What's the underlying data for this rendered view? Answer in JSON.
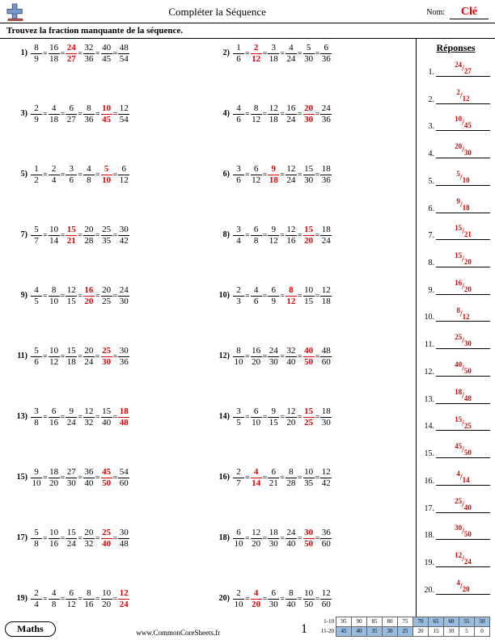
{
  "header": {
    "title": "Compléter la Séquence",
    "nom_label": "Nom:",
    "nom_value": "Clé"
  },
  "instruction": "Trouvez la fraction manquante de la séquence.",
  "answers_title": "Réponses",
  "footer": {
    "maths": "Maths",
    "site": "www.CommonCoreSheets.fr",
    "page": "1",
    "score_labels": [
      "1-10",
      "11-20"
    ],
    "score_rows": [
      [
        "95",
        "90",
        "85",
        "80",
        "75",
        "70",
        "65",
        "60",
        "55",
        "50"
      ],
      [
        "45",
        "40",
        "35",
        "30",
        "25",
        "20",
        "15",
        "10",
        "5",
        "0"
      ]
    ],
    "highlight_row2_count": 5
  },
  "problems": [
    {
      "n": 1,
      "fr": [
        [
          8,
          9
        ],
        [
          16,
          18
        ],
        [
          24,
          27
        ],
        [
          32,
          36
        ],
        [
          40,
          45
        ],
        [
          48,
          54
        ]
      ],
      "miss": 2
    },
    {
      "n": 2,
      "fr": [
        [
          1,
          6
        ],
        [
          2,
          12
        ],
        [
          3,
          18
        ],
        [
          4,
          24
        ],
        [
          5,
          30
        ],
        [
          6,
          36
        ]
      ],
      "miss": 1
    },
    {
      "n": 3,
      "fr": [
        [
          2,
          9
        ],
        [
          4,
          18
        ],
        [
          6,
          27
        ],
        [
          8,
          36
        ],
        [
          10,
          45
        ],
        [
          12,
          54
        ]
      ],
      "miss": 4
    },
    {
      "n": 4,
      "fr": [
        [
          4,
          6
        ],
        [
          8,
          12
        ],
        [
          12,
          18
        ],
        [
          16,
          24
        ],
        [
          20,
          30
        ],
        [
          24,
          36
        ]
      ],
      "miss": 4
    },
    {
      "n": 5,
      "fr": [
        [
          1,
          2
        ],
        [
          2,
          4
        ],
        [
          3,
          6
        ],
        [
          4,
          8
        ],
        [
          5,
          10
        ],
        [
          6,
          12
        ]
      ],
      "miss": 4
    },
    {
      "n": 6,
      "fr": [
        [
          3,
          6
        ],
        [
          6,
          12
        ],
        [
          9,
          18
        ],
        [
          12,
          24
        ],
        [
          15,
          30
        ],
        [
          18,
          36
        ]
      ],
      "miss": 2
    },
    {
      "n": 7,
      "fr": [
        [
          5,
          7
        ],
        [
          10,
          14
        ],
        [
          15,
          21
        ],
        [
          20,
          28
        ],
        [
          25,
          35
        ],
        [
          30,
          42
        ]
      ],
      "miss": 2
    },
    {
      "n": 8,
      "fr": [
        [
          3,
          4
        ],
        [
          6,
          8
        ],
        [
          9,
          12
        ],
        [
          12,
          16
        ],
        [
          15,
          20
        ],
        [
          18,
          24
        ]
      ],
      "miss": 4
    },
    {
      "n": 9,
      "fr": [
        [
          4,
          5
        ],
        [
          8,
          10
        ],
        [
          12,
          15
        ],
        [
          16,
          20
        ],
        [
          20,
          25
        ],
        [
          24,
          30
        ]
      ],
      "miss": 3
    },
    {
      "n": 10,
      "fr": [
        [
          2,
          3
        ],
        [
          4,
          6
        ],
        [
          6,
          9
        ],
        [
          8,
          12
        ],
        [
          10,
          15
        ],
        [
          12,
          18
        ]
      ],
      "miss": 3
    },
    {
      "n": 11,
      "fr": [
        [
          5,
          6
        ],
        [
          10,
          12
        ],
        [
          15,
          18
        ],
        [
          20,
          24
        ],
        [
          25,
          30
        ],
        [
          30,
          36
        ]
      ],
      "miss": 4
    },
    {
      "n": 12,
      "fr": [
        [
          8,
          10
        ],
        [
          16,
          20
        ],
        [
          24,
          30
        ],
        [
          32,
          40
        ],
        [
          40,
          50
        ],
        [
          48,
          60
        ]
      ],
      "miss": 4
    },
    {
      "n": 13,
      "fr": [
        [
          3,
          8
        ],
        [
          6,
          16
        ],
        [
          9,
          24
        ],
        [
          12,
          32
        ],
        [
          15,
          40
        ],
        [
          18,
          48
        ]
      ],
      "miss": 5
    },
    {
      "n": 14,
      "fr": [
        [
          3,
          5
        ],
        [
          6,
          10
        ],
        [
          9,
          15
        ],
        [
          12,
          20
        ],
        [
          15,
          25
        ],
        [
          18,
          30
        ]
      ],
      "miss": 4
    },
    {
      "n": 15,
      "fr": [
        [
          9,
          10
        ],
        [
          18,
          20
        ],
        [
          27,
          30
        ],
        [
          36,
          40
        ],
        [
          45,
          50
        ],
        [
          54,
          60
        ]
      ],
      "miss": 4
    },
    {
      "n": 16,
      "fr": [
        [
          2,
          7
        ],
        [
          4,
          14
        ],
        [
          6,
          21
        ],
        [
          8,
          28
        ],
        [
          10,
          35
        ],
        [
          12,
          42
        ]
      ],
      "miss": 1
    },
    {
      "n": 17,
      "fr": [
        [
          5,
          8
        ],
        [
          10,
          16
        ],
        [
          15,
          24
        ],
        [
          20,
          32
        ],
        [
          25,
          40
        ],
        [
          30,
          48
        ]
      ],
      "miss": 4
    },
    {
      "n": 18,
      "fr": [
        [
          6,
          10
        ],
        [
          12,
          20
        ],
        [
          18,
          30
        ],
        [
          24,
          40
        ],
        [
          30,
          50
        ],
        [
          36,
          60
        ]
      ],
      "miss": 4
    },
    {
      "n": 19,
      "fr": [
        [
          2,
          4
        ],
        [
          4,
          8
        ],
        [
          6,
          12
        ],
        [
          8,
          16
        ],
        [
          10,
          20
        ],
        [
          12,
          24
        ]
      ],
      "miss": 5
    },
    {
      "n": 20,
      "fr": [
        [
          2,
          10
        ],
        [
          4,
          20
        ],
        [
          6,
          30
        ],
        [
          8,
          40
        ],
        [
          10,
          50
        ],
        [
          12,
          60
        ]
      ],
      "miss": 1
    }
  ],
  "answers": [
    "24/27",
    "2/12",
    "10/45",
    "20/30",
    "5/10",
    "9/18",
    "15/21",
    "15/20",
    "16/20",
    "8/12",
    "25/30",
    "40/50",
    "18/48",
    "15/25",
    "45/50",
    "4/14",
    "25/40",
    "30/50",
    "12/24",
    "4/20"
  ]
}
